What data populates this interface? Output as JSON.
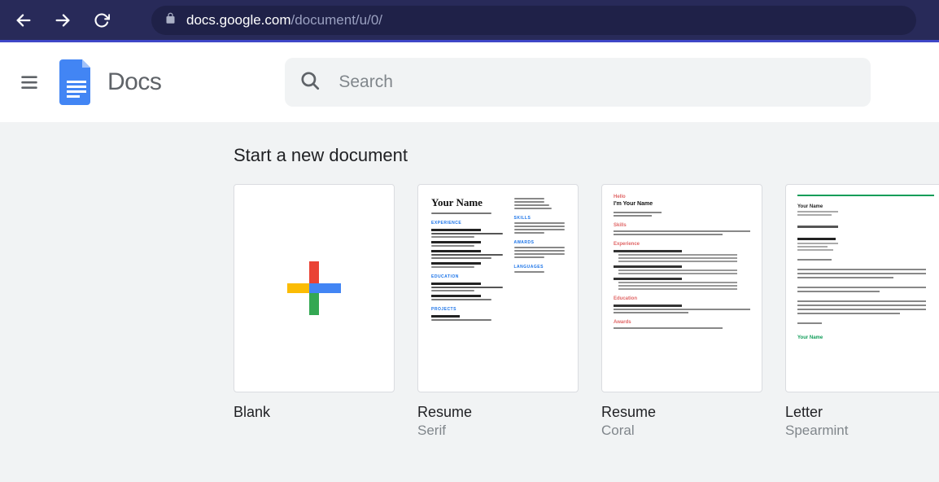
{
  "browser": {
    "url_host": "docs.google.com",
    "url_path": "/document/u/0/"
  },
  "header": {
    "app_title": "Docs",
    "search_placeholder": "Search"
  },
  "templates": {
    "section_title": "Start a new document",
    "cards": [
      {
        "title": "Blank",
        "subtitle": ""
      },
      {
        "title": "Resume",
        "subtitle": "Serif"
      },
      {
        "title": "Resume",
        "subtitle": "Coral"
      },
      {
        "title": "Letter",
        "subtitle": "Spearmint"
      }
    ]
  }
}
